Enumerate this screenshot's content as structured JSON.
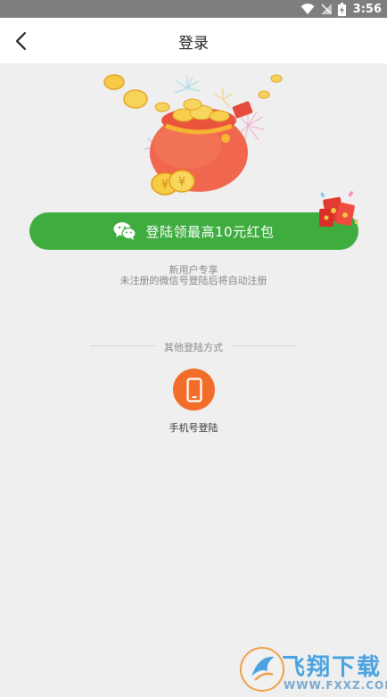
{
  "status_bar": {
    "time": "3:56",
    "icons": [
      "wifi-icon",
      "signal-off-icon",
      "battery-charging-icon"
    ]
  },
  "header": {
    "title": "登录",
    "back_icon": "chevron-left-icon"
  },
  "wechat": {
    "button_label": "登陆领最高10元红包",
    "icon": "wechat-icon",
    "color": "#3eac3f"
  },
  "notes": {
    "line1": "新用户专享",
    "line2": "未注册的微信号登陆后将自动注册"
  },
  "other_login": {
    "divider_text": "其他登陆方式",
    "phone_label": "手机号登陆",
    "phone_icon": "phone-icon",
    "phone_color": "#f26d2a"
  },
  "watermark": {
    "text": "飞翔下载",
    "url": "WWW.FXXZ.COM"
  }
}
